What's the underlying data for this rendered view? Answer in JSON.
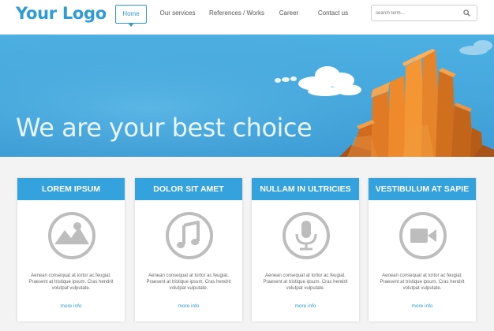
{
  "header": {
    "logo": "Your Logo",
    "nav": [
      "Home",
      "Our services",
      "References / Works",
      "Career",
      "Contact us"
    ],
    "search_placeholder": "search term..."
  },
  "hero": {
    "title": "We are your best choice"
  },
  "cards": [
    {
      "title": "LOREM IPSUM",
      "icon": "image-icon",
      "text": "Aenean consequat at tortor ac feugiat. Praesent at tristique ipsum. Cras hendrit volutpat vulputate.",
      "link": "more info"
    },
    {
      "title": "DOLOR SIT AMET",
      "icon": "music-note-icon",
      "text": "Aenean consequat at tortor ac feugiat. Praesent at tristique ipsum. Cras hendrit volutpat vulputate.",
      "link": "more info"
    },
    {
      "title": "NULLAM IN ULTRICIES",
      "icon": "microphone-icon",
      "text": "Aenean consequat at tortor ac feugiat. Praesent at tristique ipsum. Cras hendrit volutpat vulputate.",
      "link": "more info"
    },
    {
      "title": "VESTIBULUM AT SAPIE",
      "icon": "video-camera-icon",
      "text": "Aenean consequat at tortor ac feugiat. Praesent at tristique ipsum. Cras hendrit volutpat vulputate.",
      "link": "more info"
    }
  ],
  "colors": {
    "accent": "#2f9bd3",
    "card_header": "#34a2dc",
    "icon_gray": "#bdbdbd"
  }
}
